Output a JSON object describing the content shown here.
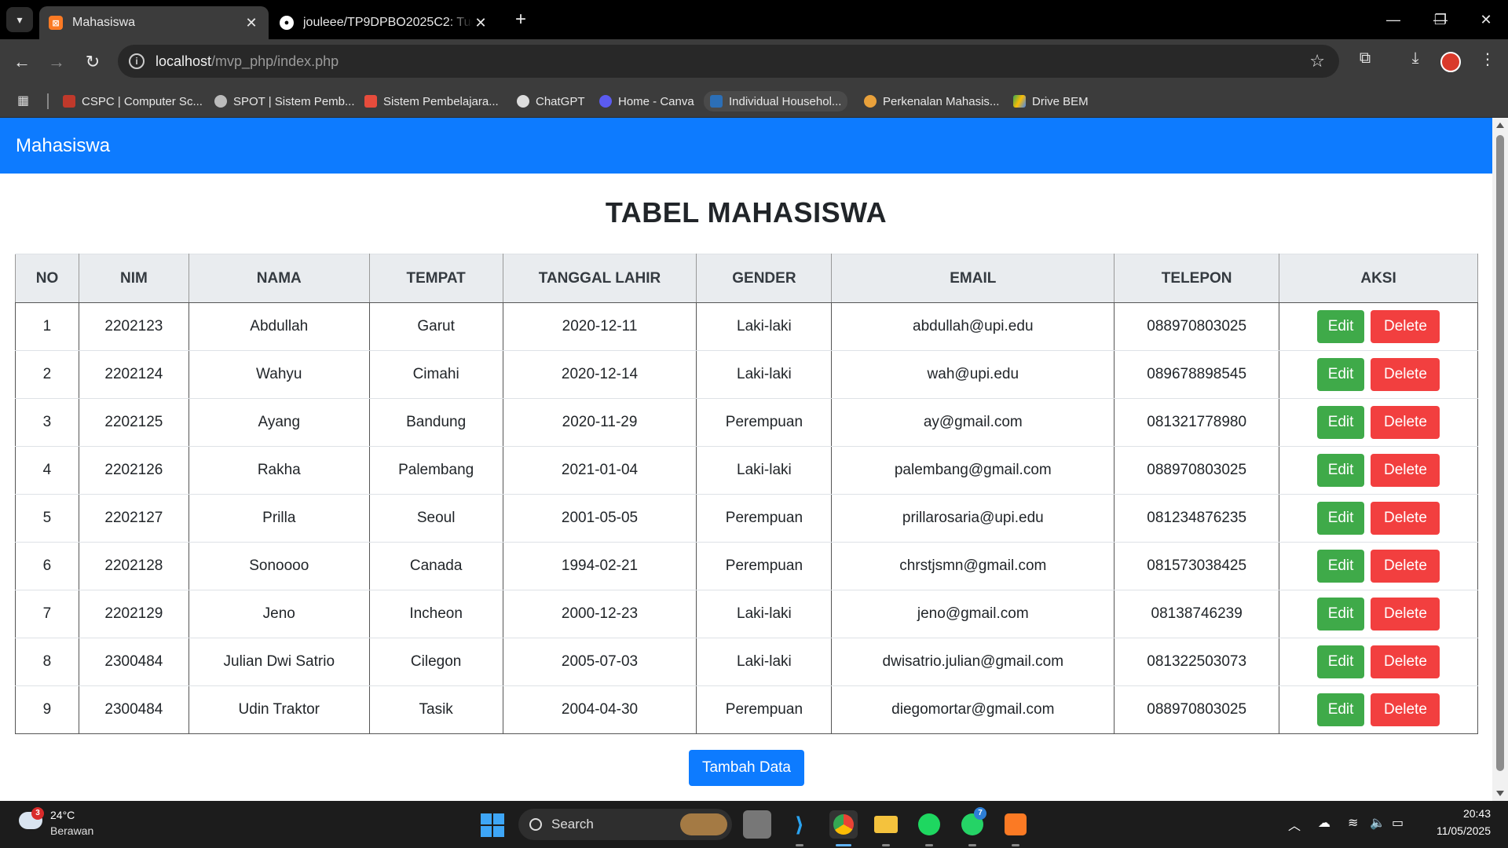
{
  "browser": {
    "tabs": [
      {
        "title": "Mahasiswa",
        "active": true
      },
      {
        "title": "jouleee/TP9DPBO2025C2: Tugas",
        "active": false
      }
    ],
    "url_host": "localhost",
    "url_path": "/mvp_php/index.php",
    "bookmarks": [
      "CSPC | Computer Sc...",
      "SPOT | Sistem Pemb...",
      "Sistem Pembelajara...",
      "ChatGPT",
      "Home - Canva",
      "Individual Househol...",
      "Perkenalan Mahasis...",
      "Drive BEM"
    ]
  },
  "page": {
    "brand": "Mahasiswa",
    "heading": "TABEL MAHASISWA",
    "columns": [
      "NO",
      "NIM",
      "NAMA",
      "TEMPAT",
      "TANGGAL LAHIR",
      "GENDER",
      "EMAIL",
      "TELEPON",
      "AKSI"
    ],
    "rows": [
      {
        "no": "1",
        "nim": "2202123",
        "nama": "Abdullah",
        "tempat": "Garut",
        "tanggal": "2020-12-11",
        "gender": "Laki-laki",
        "email": "abdullah@upi.edu",
        "telepon": "088970803025"
      },
      {
        "no": "2",
        "nim": "2202124",
        "nama": "Wahyu",
        "tempat": "Cimahi",
        "tanggal": "2020-12-14",
        "gender": "Laki-laki",
        "email": "wah@upi.edu",
        "telepon": "089678898545"
      },
      {
        "no": "3",
        "nim": "2202125",
        "nama": "Ayang",
        "tempat": "Bandung",
        "tanggal": "2020-11-29",
        "gender": "Perempuan",
        "email": "ay@gmail.com",
        "telepon": "081321778980"
      },
      {
        "no": "4",
        "nim": "2202126",
        "nama": "Rakha",
        "tempat": "Palembang",
        "tanggal": "2021-01-04",
        "gender": "Laki-laki",
        "email": "palembang@gmail.com",
        "telepon": "088970803025"
      },
      {
        "no": "5",
        "nim": "2202127",
        "nama": "Prilla",
        "tempat": "Seoul",
        "tanggal": "2001-05-05",
        "gender": "Perempuan",
        "email": "prillarosaria@upi.edu",
        "telepon": "081234876235"
      },
      {
        "no": "6",
        "nim": "2202128",
        "nama": "Sonoooo",
        "tempat": "Canada",
        "tanggal": "1994-02-21",
        "gender": "Perempuan",
        "email": "chrstjsmn@gmail.com",
        "telepon": "081573038425"
      },
      {
        "no": "7",
        "nim": "2202129",
        "nama": "Jeno",
        "tempat": "Incheon",
        "tanggal": "2000-12-23",
        "gender": "Laki-laki",
        "email": "jeno@gmail.com",
        "telepon": "08138746239"
      },
      {
        "no": "8",
        "nim": "2300484",
        "nama": "Julian Dwi Satrio",
        "tempat": "Cilegon",
        "tanggal": "2005-07-03",
        "gender": "Laki-laki",
        "email": "dwisatrio.julian@gmail.com",
        "telepon": "081322503073"
      },
      {
        "no": "9",
        "nim": "2300484",
        "nama": "Udin Traktor",
        "tempat": "Tasik",
        "tanggal": "2004-04-30",
        "gender": "Perempuan",
        "email": "diegomortar@gmail.com",
        "telepon": "088970803025"
      }
    ],
    "edit_label": "Edit",
    "delete_label": "Delete",
    "add_label": "Tambah Data"
  },
  "taskbar": {
    "weather_temp": "24°C",
    "weather_desc": "Berawan",
    "weather_badge": "3",
    "search_label": "Search",
    "whatsapp_badge": "7",
    "time": "20:43",
    "date": "11/05/2025"
  },
  "colors": {
    "navbar": "#0d7bff",
    "edit": "#3faa49",
    "delete": "#f23f3f",
    "add": "#0d7bff"
  }
}
